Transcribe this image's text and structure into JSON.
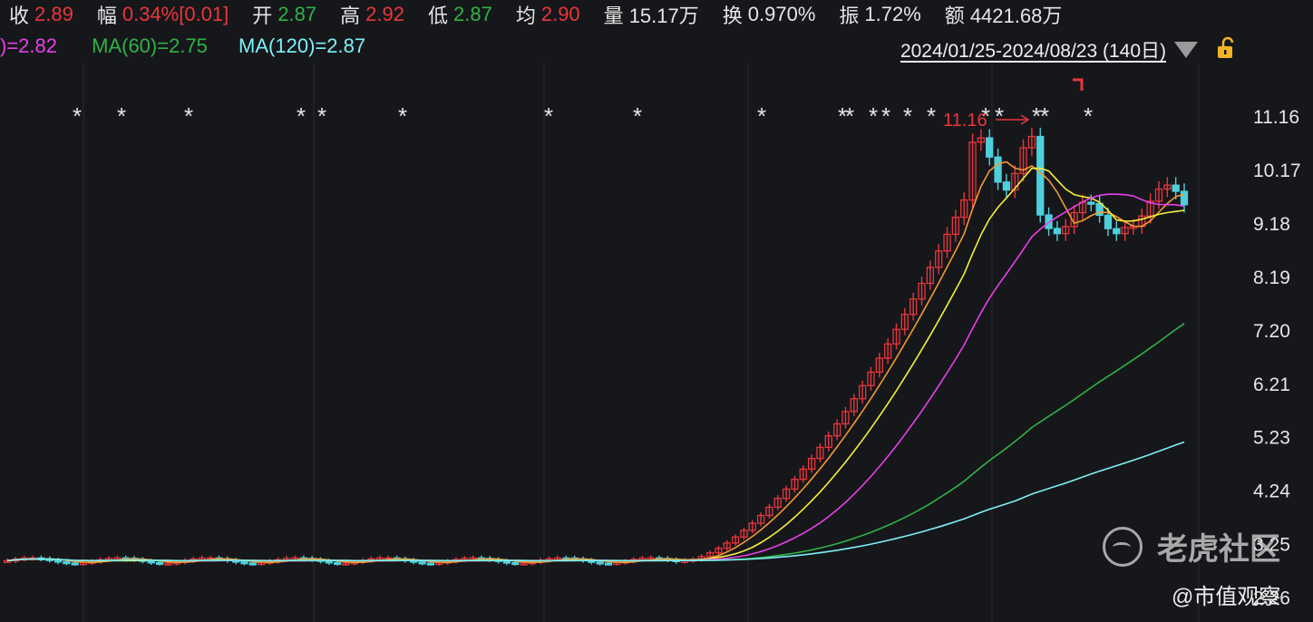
{
  "header": {
    "items": [
      {
        "key": "收",
        "value": "2.89",
        "color": "#e8373b"
      },
      {
        "key": "幅",
        "value": "0.34%[0.01]",
        "color": "#e8373b"
      },
      {
        "key": "开",
        "value": "2.87",
        "color": "#2fb344"
      },
      {
        "key": "高",
        "value": "2.92",
        "color": "#e8373b"
      },
      {
        "key": "低",
        "value": "2.87",
        "color": "#2fb344"
      },
      {
        "key": "均",
        "value": "2.90",
        "color": "#e8373b"
      },
      {
        "key": "量",
        "value": "15.17万",
        "color": "#e6e6e6"
      },
      {
        "key": "换",
        "value": "0.970%",
        "color": "#e6e6e6"
      },
      {
        "key": "振",
        "value": "1.72%",
        "color": "#e6e6e6"
      },
      {
        "key": "额",
        "value": "4421.68万",
        "color": "#e6e6e6"
      }
    ]
  },
  "ma_legend": [
    {
      "label": ")=2.82",
      "color": "#e83fe8"
    },
    {
      "label": "MA(60)=2.75",
      "color": "#2fb344"
    },
    {
      "label": "MA(120)=2.87",
      "color": "#7ef1f5"
    }
  ],
  "date_range": "2024/01/25-2024/08/23 (140日)",
  "icons": {
    "dropdown": "triangle-down-icon",
    "lock": "lock-icon"
  },
  "watermark": {
    "brand": "老虎社区",
    "handle": "@市值观察"
  },
  "chart_data": {
    "type": "candlestick",
    "y_ticks": [
      "11.16",
      "10.17",
      "9.18",
      "8.19",
      "7.20",
      "6.21",
      "5.23",
      "4.24",
      "3.25",
      "2.26"
    ],
    "high_annotation": "11.16",
    "colors": {
      "up": "#e8373b",
      "down": "#4ecfdc",
      "ma_orange": "#f39a2f",
      "ma_yellow": "#f5f03a",
      "ma_magenta": "#e83fe8",
      "ma_green": "#2fb344",
      "ma_cyan": "#7ef1f5"
    },
    "marks_count": 17
  }
}
